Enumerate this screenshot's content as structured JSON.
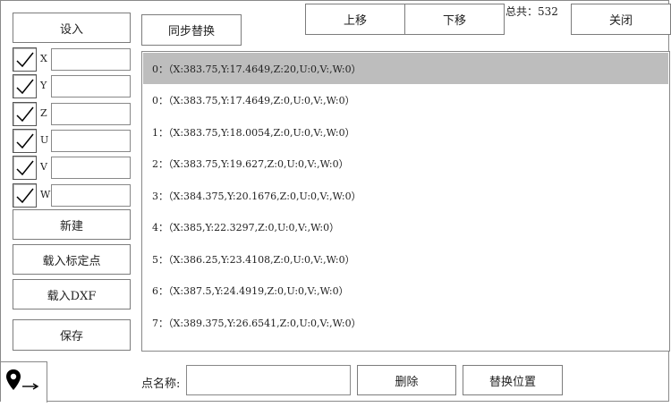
{
  "left_panel": {
    "set_in_label": "设入",
    "axes": [
      {
        "label": "X",
        "checked": true,
        "value": ""
      },
      {
        "label": "Y",
        "checked": true,
        "value": ""
      },
      {
        "label": "Z",
        "checked": true,
        "value": ""
      },
      {
        "label": "U",
        "checked": true,
        "value": ""
      },
      {
        "label": "V",
        "checked": true,
        "value": ""
      },
      {
        "label": "W",
        "checked": true,
        "value": ""
      }
    ],
    "new_label": "新建",
    "load_calib_label": "载入标定点",
    "load_dxf_label": "载入DXF",
    "save_label": "保存"
  },
  "toolbar": {
    "sync_replace_label": "同步替换",
    "move_up_label": "上移",
    "move_down_label": "下移",
    "total_text": "总共：532",
    "close_label": "关闭"
  },
  "points": [
    {
      "text": "0：（X:383.75,Y:17.4649,Z:20,U:0,V:,W:0）",
      "selected": true
    },
    {
      "text": "0：（X:383.75,Y:17.4649,Z:0,U:0,V:,W:0）",
      "selected": false
    },
    {
      "text": "1：（X:383.75,Y:18.0054,Z:0,U:0,V:,W:0）",
      "selected": false
    },
    {
      "text": "2：（X:383.75,Y:19.627,Z:0,U:0,V:,W:0）",
      "selected": false
    },
    {
      "text": "3：（X:384.375,Y:20.1676,Z:0,U:0,V:,W:0）",
      "selected": false
    },
    {
      "text": "4：（X:385,Y:22.3297,Z:0,U:0,V:,W:0）",
      "selected": false
    },
    {
      "text": "5：（X:386.25,Y:23.4108,Z:0,U:0,V:,W:0）",
      "selected": false
    },
    {
      "text": "6：（X:387.5,Y:24.4919,Z:0,U:0,V:,W:0）",
      "selected": false
    },
    {
      "text": "7：（X:389.375,Y:26.6541,Z:0,U:0,V:,W:0）",
      "selected": false
    }
  ],
  "bottom": {
    "point_name_label": "点名称:",
    "point_name_value": "",
    "delete_label": "删除",
    "replace_position_label": "替换位置",
    "locate_icon": "map-pin-arrow-icon"
  }
}
